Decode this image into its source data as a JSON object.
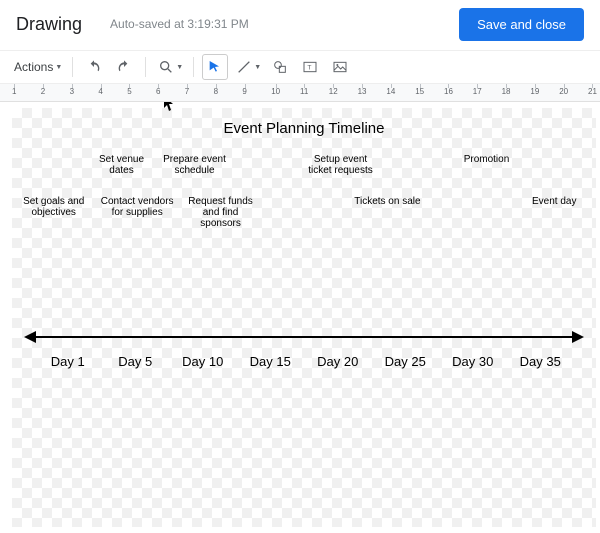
{
  "header": {
    "app_title": "Drawing",
    "autosave_text": "Auto-saved at 3:19:31 PM",
    "save_button": "Save and close"
  },
  "toolbar": {
    "actions_label": "Actions",
    "tools": {
      "undo": "undo",
      "redo": "redo",
      "zoom": "zoom",
      "select": "select",
      "line": "line",
      "shape": "shape",
      "textbox": "text-box",
      "image": "image"
    }
  },
  "ruler": {
    "start": 1,
    "end": 21
  },
  "drawing": {
    "title": "Event Planning Timeline",
    "activities_row1": [
      "",
      "Set venue dates",
      "Prepare event schedule",
      "",
      "Setup event ticket requests",
      "",
      "Promotion",
      ""
    ],
    "activities_row2": [
      "Set goals and objectives",
      "Contact vendors for supplies",
      "Request funds and find sponsors",
      "",
      "Tickets on sale",
      "",
      "Event day"
    ],
    "day_labels": [
      "Day 1",
      "Day 5",
      "Day 10",
      "Day 15",
      "Day 20",
      "Day 25",
      "Day 30",
      "Day 35"
    ]
  },
  "chart_data": {
    "type": "line",
    "categories": [
      "Day 1",
      "Day 5",
      "Day 10",
      "Day 15",
      "Day 20",
      "Day 25",
      "Day 30",
      "Day 35"
    ],
    "values": [
      1,
      5,
      10,
      15,
      20,
      25,
      30,
      35
    ],
    "title": "Event Planning Timeline",
    "xlabel": "Day",
    "ylabel": "",
    "annotations": [
      "Set goals and objectives",
      "Set venue dates",
      "Contact vendors for supplies",
      "Prepare event schedule",
      "Request funds and find sponsors",
      "Setup event ticket requests",
      "Tickets on sale",
      "Promotion",
      "Event day"
    ]
  }
}
